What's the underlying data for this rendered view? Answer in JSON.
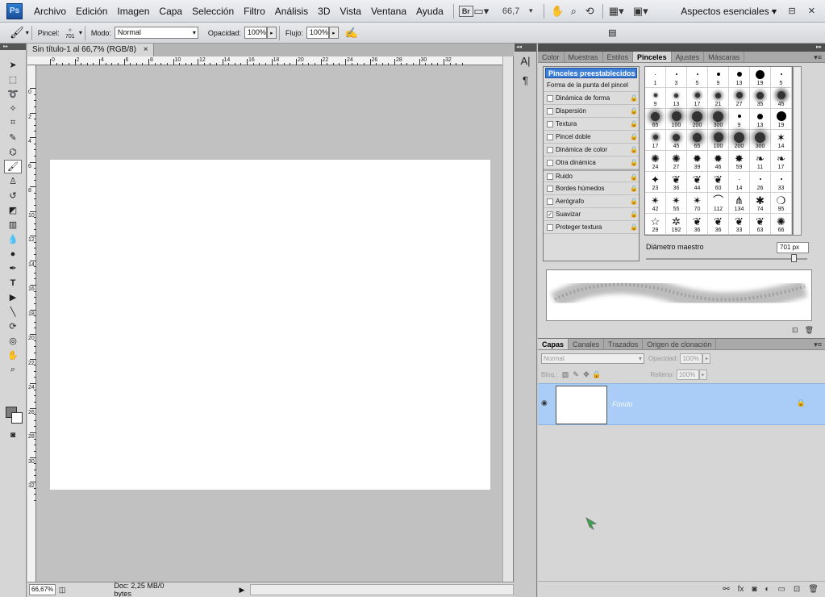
{
  "app": {
    "logo": "Ps",
    "workspace": "Aspectos esenciales",
    "window_controls": "–  ⊟  ✕"
  },
  "menu": [
    "Archivo",
    "Edición",
    "Imagen",
    "Capa",
    "Selección",
    "Filtro",
    "Análisis",
    "3D",
    "Vista",
    "Ventana",
    "Ayuda"
  ],
  "menubar_tools": {
    "bridge": "Br",
    "zoom": "66,7"
  },
  "options_bar": {
    "brush_label": "Pincel:",
    "brush_size": "701",
    "mode_label": "Modo:",
    "mode_value": "Normal",
    "opacity_label": "Opacidad:",
    "opacity_value": "100%",
    "flow_label": "Flujo:",
    "flow_value": "100%"
  },
  "document": {
    "tab_title": "Sin título-1 al 66,7% (RGB/8)",
    "close": "×",
    "zoom_status": "66,67%",
    "doc_info": "Doc: 2,25 MB/0 bytes",
    "ruler_top": [
      "0",
      "2",
      "4",
      "6",
      "8",
      "10",
      "12",
      "14",
      "16",
      "18",
      "20",
      "22",
      "24",
      "26",
      "28",
      "30",
      "32"
    ],
    "ruler_left": [
      "0",
      "2",
      "4",
      "6",
      "8",
      "10",
      "12",
      "14",
      "16",
      "18",
      "20",
      "22",
      "24",
      "26",
      "28",
      "30",
      "32"
    ]
  },
  "brushes_panel": {
    "tabs": [
      "Color",
      "Muestras",
      "Estilos",
      "Pinceles",
      "Ajustes",
      "Máscaras"
    ],
    "active_tab": "Pinceles",
    "presets_button": "Pinceles preestablecidos",
    "options": [
      {
        "label": "Forma de la punta del pincel",
        "checkbox": false,
        "checked": false,
        "lock": false
      },
      {
        "label": "Dinámica de forma",
        "checkbox": true,
        "checked": false,
        "lock": true
      },
      {
        "label": "Dispersión",
        "checkbox": true,
        "checked": false,
        "lock": true
      },
      {
        "label": "Textura",
        "checkbox": true,
        "checked": false,
        "lock": true
      },
      {
        "label": "Pincel doble",
        "checkbox": true,
        "checked": false,
        "lock": true
      },
      {
        "label": "Dinámica de color",
        "checkbox": true,
        "checked": false,
        "lock": true
      },
      {
        "label": "Otra dinámica",
        "checkbox": true,
        "checked": false,
        "lock": true
      },
      {
        "label": "Ruido",
        "checkbox": true,
        "checked": false,
        "lock": true
      },
      {
        "label": "Bordes húmedos",
        "checkbox": true,
        "checked": false,
        "lock": true
      },
      {
        "label": "Aerógrafo",
        "checkbox": true,
        "checked": false,
        "lock": true
      },
      {
        "label": "Suavizar",
        "checkbox": true,
        "checked": true,
        "lock": true
      },
      {
        "label": "Proteger textura",
        "checkbox": true,
        "checked": false,
        "lock": true
      }
    ],
    "grid": [
      {
        "n": "1",
        "k": "dot",
        "s": 1
      },
      {
        "n": "3",
        "k": "dot",
        "s": 2
      },
      {
        "n": "5",
        "k": "dot",
        "s": 2
      },
      {
        "n": "9",
        "k": "dot",
        "s": 4
      },
      {
        "n": "13",
        "k": "dot",
        "s": 6
      },
      {
        "n": "19",
        "k": "dot",
        "s": 11
      },
      {
        "n": "5",
        "k": "dot",
        "s": 2
      },
      {
        "n": "9",
        "k": "soft",
        "s": 4
      },
      {
        "n": "13",
        "k": "soft",
        "s": 5
      },
      {
        "n": "17",
        "k": "soft",
        "s": 6
      },
      {
        "n": "21",
        "k": "soft",
        "s": 7
      },
      {
        "n": "27",
        "k": "soft",
        "s": 8
      },
      {
        "n": "35",
        "k": "soft",
        "s": 9
      },
      {
        "n": "45",
        "k": "soft",
        "s": 10
      },
      {
        "n": "65",
        "k": "soft",
        "s": 11
      },
      {
        "n": "100",
        "k": "soft",
        "s": 12
      },
      {
        "n": "200",
        "k": "soft",
        "s": 13
      },
      {
        "n": "300",
        "k": "soft",
        "s": 13
      },
      {
        "n": "9",
        "k": "dot",
        "s": 4
      },
      {
        "n": "13",
        "k": "dot",
        "s": 7
      },
      {
        "n": "19",
        "k": "dot",
        "s": 12
      },
      {
        "n": "17",
        "k": "soft",
        "s": 6
      },
      {
        "n": "45",
        "k": "soft",
        "s": 9
      },
      {
        "n": "65",
        "k": "soft",
        "s": 11
      },
      {
        "n": "100",
        "k": "soft",
        "s": 12
      },
      {
        "n": "200",
        "k": "soft",
        "s": 13
      },
      {
        "n": "300",
        "k": "soft",
        "s": 13
      },
      {
        "n": "14",
        "k": "spray",
        "g": "✶"
      },
      {
        "n": "24",
        "k": "spray",
        "g": "✺"
      },
      {
        "n": "27",
        "k": "spray",
        "g": "✺"
      },
      {
        "n": "39",
        "k": "spray",
        "g": "✹"
      },
      {
        "n": "46",
        "k": "spray",
        "g": "✹"
      },
      {
        "n": "59",
        "k": "spray",
        "g": "✸"
      },
      {
        "n": "11",
        "k": "spray",
        "g": "❧"
      },
      {
        "n": "17",
        "k": "spray",
        "g": "❧"
      },
      {
        "n": "23",
        "k": "spray",
        "g": "✦"
      },
      {
        "n": "36",
        "k": "spray",
        "g": "❦"
      },
      {
        "n": "44",
        "k": "spray",
        "g": "❦"
      },
      {
        "n": "60",
        "k": "spray",
        "g": "❦"
      },
      {
        "n": "14",
        "k": "dot",
        "s": 1
      },
      {
        "n": "26",
        "k": "dot",
        "s": 2
      },
      {
        "n": "33",
        "k": "dot",
        "s": 2
      },
      {
        "n": "42",
        "k": "spray",
        "g": "✴"
      },
      {
        "n": "55",
        "k": "spray",
        "g": "✴"
      },
      {
        "n": "70",
        "k": "spray",
        "g": "✴"
      },
      {
        "n": "112",
        "k": "spray",
        "g": "⌒"
      },
      {
        "n": "134",
        "k": "spray",
        "g": "⋔"
      },
      {
        "n": "74",
        "k": "spray",
        "g": "✱"
      },
      {
        "n": "95",
        "k": "spray",
        "g": "❍"
      },
      {
        "n": "29",
        "k": "spray",
        "g": "☆"
      },
      {
        "n": "192",
        "k": "spray",
        "g": "✲"
      },
      {
        "n": "36",
        "k": "spray",
        "g": "❦"
      },
      {
        "n": "36",
        "k": "spray",
        "g": "❦"
      },
      {
        "n": "33",
        "k": "spray",
        "g": "❦"
      },
      {
        "n": "63",
        "k": "spray",
        "g": "❦"
      },
      {
        "n": "66",
        "k": "spray",
        "g": "✺"
      }
    ],
    "diameter_label": "Diámetro maestro",
    "diameter_value": "701 px",
    "diameter_fraction": 0.92
  },
  "layers_panel": {
    "tabs": [
      "Capas",
      "Canales",
      "Trazados",
      "Origen de clonación"
    ],
    "active_tab": "Capas",
    "blend_mode": "Normal",
    "opacity_label": "Opacidad:",
    "opacity_value": "100%",
    "lock_label": "Bloq.:",
    "fill_label": "Relleno:",
    "fill_value": "100%",
    "layer_name": "Fondo",
    "footer_icons": [
      "link-icon",
      "fx-icon",
      "mask-icon",
      "adjustment-icon",
      "group-icon",
      "new-layer-icon",
      "trash-icon"
    ]
  },
  "colors": {
    "selection_blue": "#a9cdf6",
    "preset_button": "#3d7ed6",
    "foreground": "#7d7d7d",
    "background": "#ffffff"
  }
}
